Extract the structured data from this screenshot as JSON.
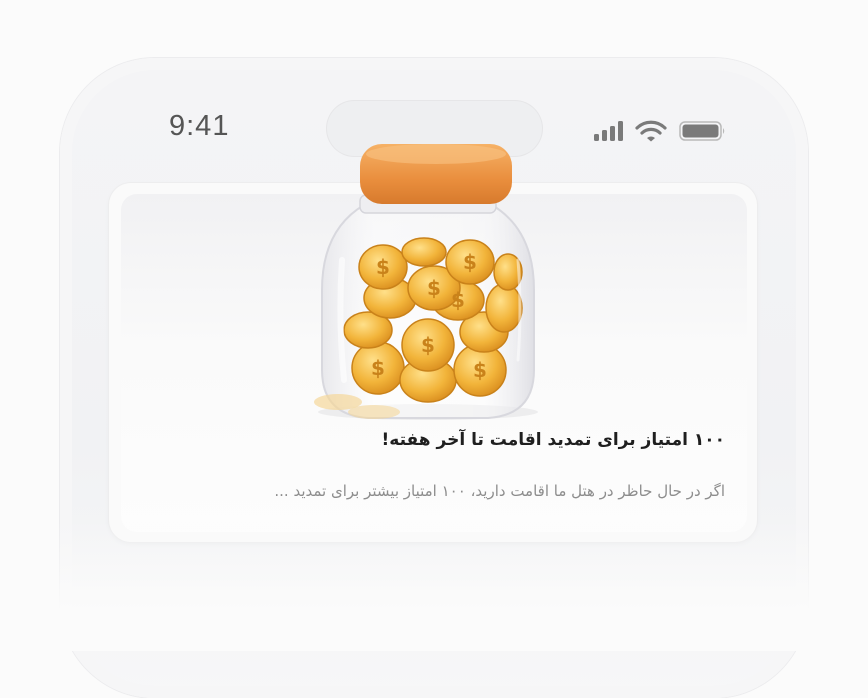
{
  "status_bar": {
    "time": "9:41",
    "icons": [
      "cellular-signal-icon",
      "wifi-icon",
      "battery-icon"
    ]
  },
  "notification": {
    "image": "coin-jar-illustration",
    "title": "۱۰۰ امتیاز برای تمدید اقامت تا آخر هفته!",
    "body": "اگر در حال حاظر در هتل ما اقامت دارید، ۱۰۰ امتیاز بیشتر برای تمدید ..."
  },
  "colors": {
    "jar_lid": "#ee9a4a",
    "coins": "#f2b43a",
    "title_text": "#1f1f1f",
    "body_text": "#8d8d8d"
  }
}
